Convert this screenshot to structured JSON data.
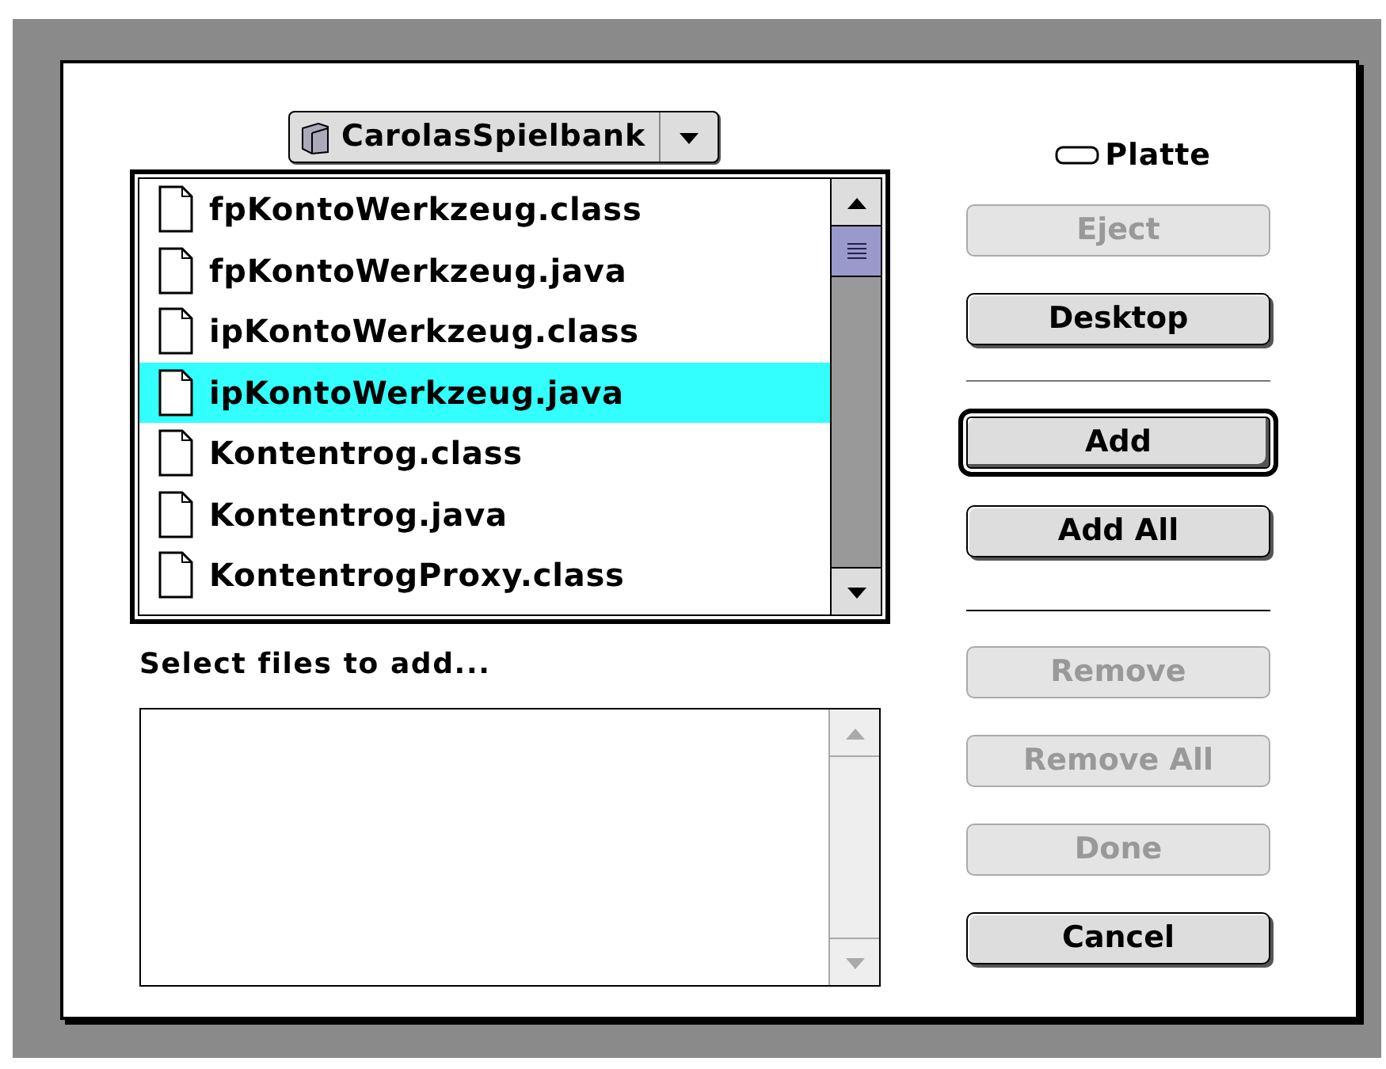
{
  "folder_popup": {
    "label": "CarolasSpielbank"
  },
  "volume": {
    "label": "Platte"
  },
  "files": [
    {
      "name": "fpKontoWerkzeug.class",
      "selected": false
    },
    {
      "name": "fpKontoWerkzeug.java",
      "selected": false
    },
    {
      "name": "ipKontoWerkzeug.class",
      "selected": false
    },
    {
      "name": "ipKontoWerkzeug.java",
      "selected": true
    },
    {
      "name": "Kontentrog.class",
      "selected": false
    },
    {
      "name": "Kontentrog.java",
      "selected": false
    },
    {
      "name": "KontentrogProxy.class",
      "selected": false
    }
  ],
  "prompt": "Select files to add...",
  "button_groups": [
    [
      {
        "label": "Eject",
        "disabled": true,
        "default": false
      },
      {
        "label": "Desktop",
        "disabled": false,
        "default": false
      }
    ],
    [
      {
        "label": "Add",
        "disabled": false,
        "default": true
      },
      {
        "label": "Add All",
        "disabled": false,
        "default": false
      }
    ],
    [
      {
        "label": "Remove",
        "disabled": true,
        "default": false
      },
      {
        "label": "Remove All",
        "disabled": true,
        "default": false
      },
      {
        "label": "Done",
        "disabled": true,
        "default": false
      },
      {
        "label": "Cancel",
        "disabled": false,
        "default": false
      }
    ]
  ]
}
